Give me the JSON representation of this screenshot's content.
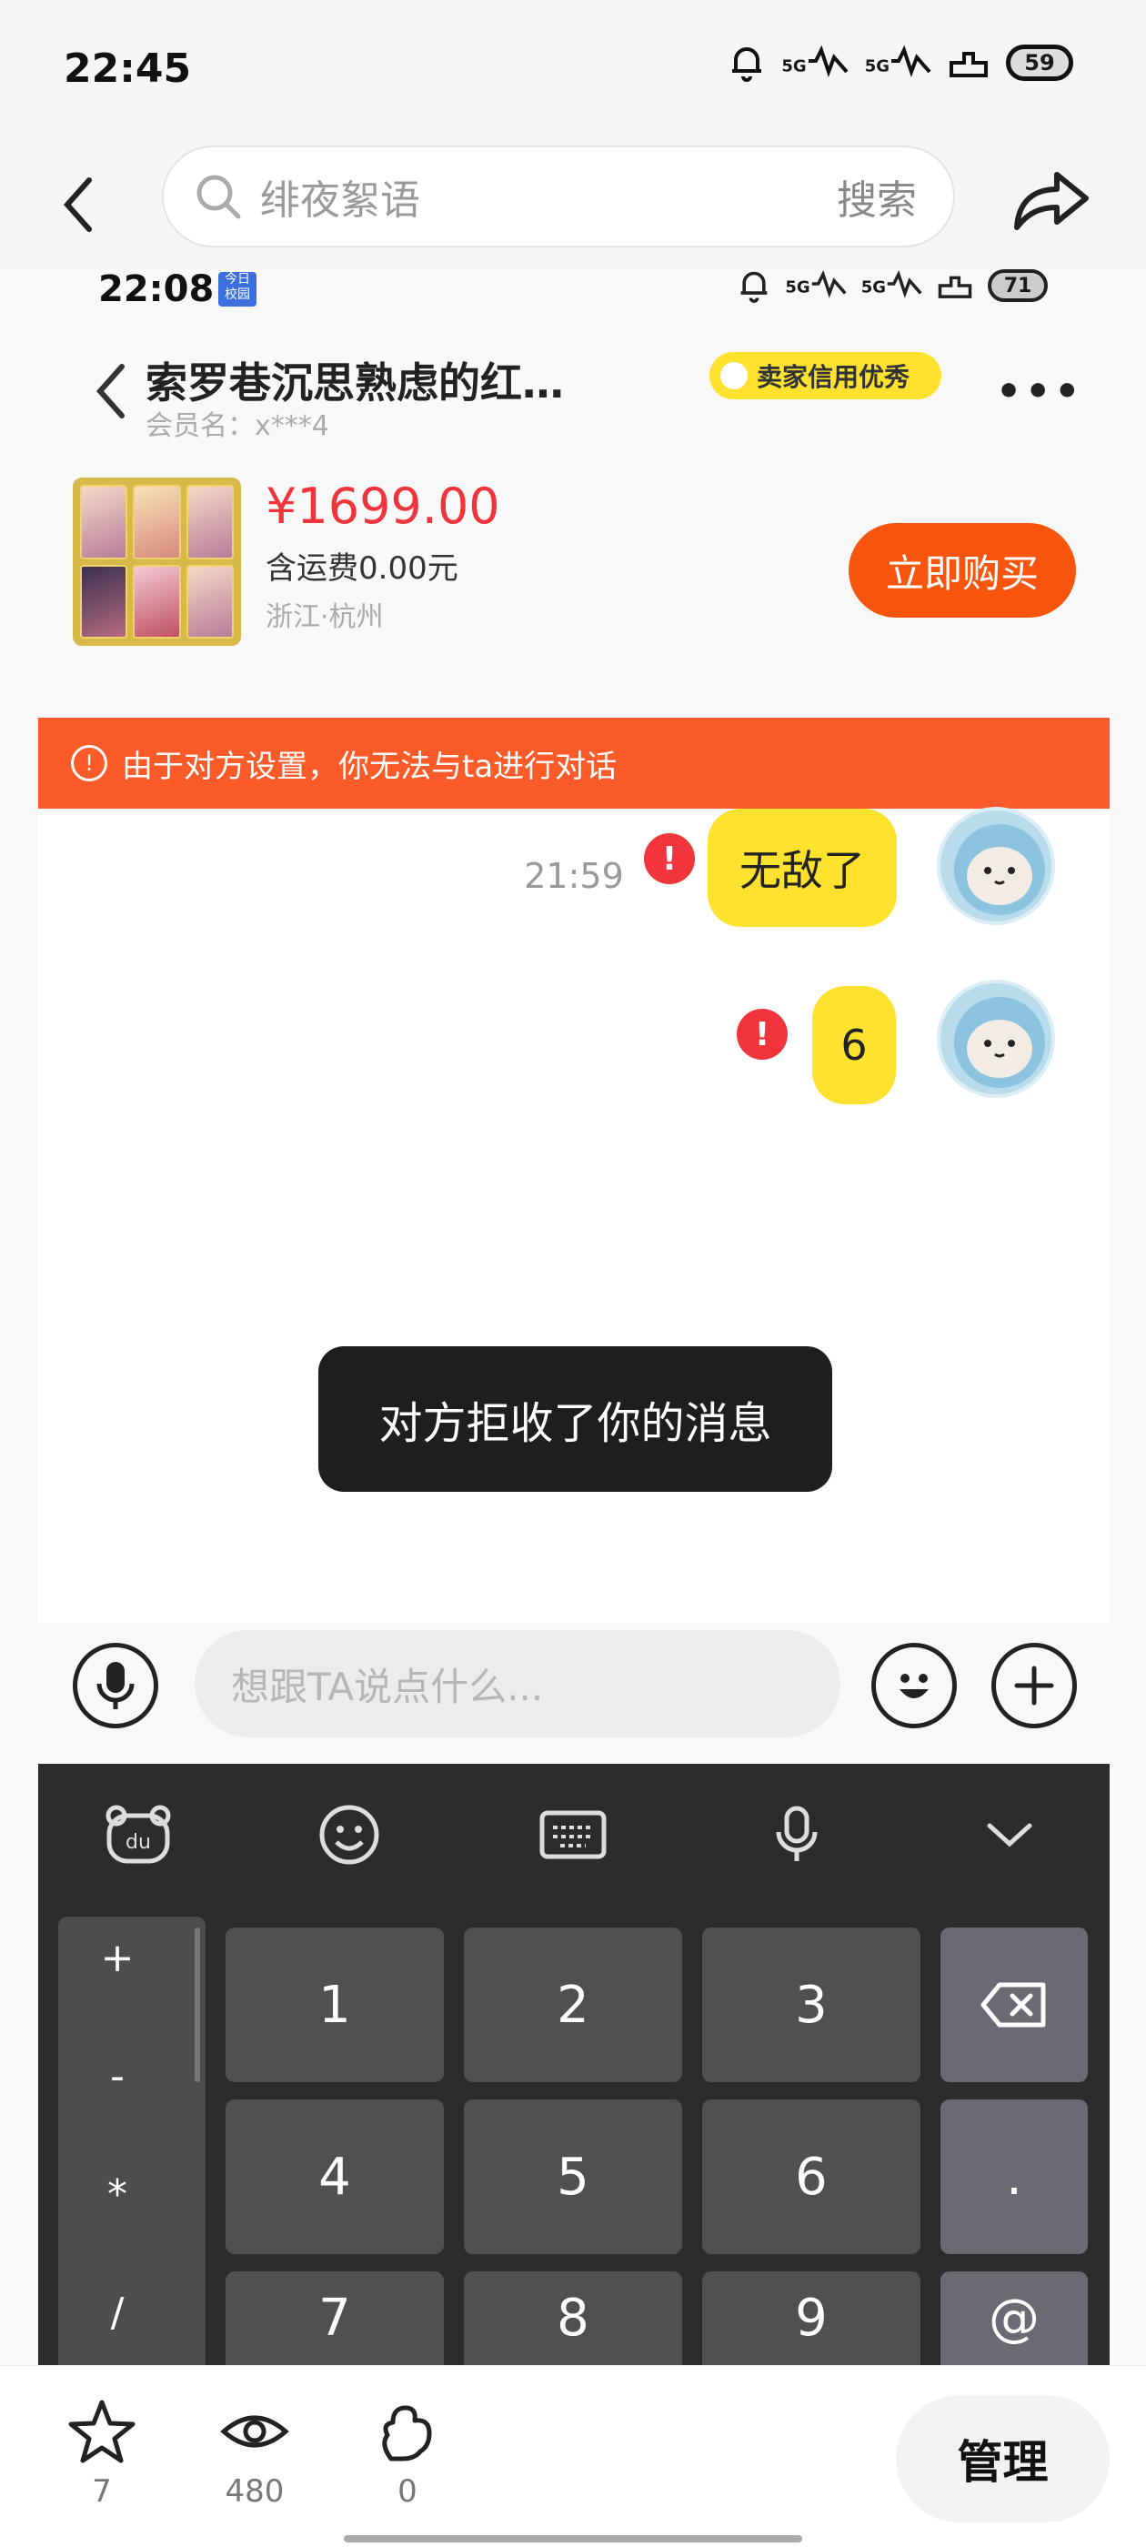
{
  "outer_status": {
    "time": "22:45",
    "network1": "5G",
    "network2": "5G",
    "battery": "59"
  },
  "outer_nav": {
    "search_placeholder": "绯夜絮语",
    "search_button": "搜索"
  },
  "inner_status": {
    "time": "22:08",
    "badge": "今日\n校园",
    "network1": "5G",
    "network2": "5G",
    "battery": "71"
  },
  "chat_header": {
    "title": "索罗巷沉思熟虑的红…",
    "member": "会员名：x***4",
    "seller_badge": "卖家信用优秀",
    "more": "•••"
  },
  "product": {
    "price": "¥1699.00",
    "shipping": "含运费0.00元",
    "location": "浙江·杭州",
    "buy_label": "立即购买"
  },
  "warning": {
    "icon": "!",
    "text": "由于对方设置，你无法与ta进行对话"
  },
  "chat": {
    "timestamp": "21:59",
    "messages": [
      {
        "text": "无敌了",
        "failed": true
      },
      {
        "text": "6",
        "failed": true
      }
    ],
    "toast": "对方拒收了你的消息"
  },
  "input": {
    "placeholder": "想跟TA说点什么..."
  },
  "keyboard": {
    "side_keys": [
      "+",
      "-",
      "*",
      "/"
    ],
    "keys": [
      "1",
      "2",
      "3",
      "4",
      "5",
      "6",
      ".",
      "7",
      "8",
      "9",
      "@"
    ]
  },
  "bottom_bar": {
    "favorites": "7",
    "views": "480",
    "likes": "0",
    "manage_label": "管理"
  },
  "colors": {
    "accent_orange": "#f7540e",
    "price_red": "#f0343c",
    "bubble_yellow": "#ffe22e",
    "warn_orange": "#fb5b28"
  }
}
